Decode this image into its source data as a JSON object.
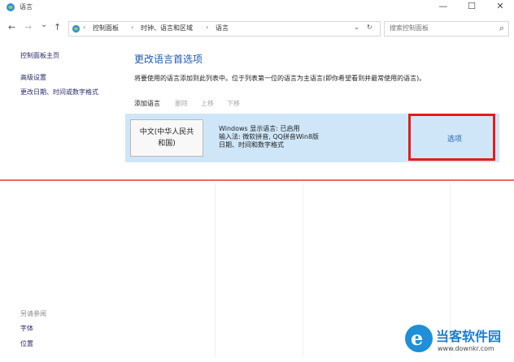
{
  "window": {
    "title": "语言",
    "minimize": "—",
    "maximize": "☐",
    "close": "✕"
  },
  "address": {
    "back": "←",
    "forward": "→",
    "recent": "⌄",
    "up": "↑",
    "path": [
      "控制面板",
      "时钟、语言和区域",
      "语言"
    ],
    "separator": "›",
    "dropdown": "⌄",
    "refresh": "↻",
    "search_placeholder": "搜索控制面板",
    "search_icon": "⌕"
  },
  "sidebar": {
    "home": "控制面板主页",
    "advanced": "高级设置",
    "change_date": "更改日期、时间或数字格式",
    "see_also": "另请参阅",
    "font": "字体",
    "location": "位置"
  },
  "main": {
    "heading": "更改语言首选项",
    "description": "将要使用的语言添加到此列表中。位于列表第一位的语言为主语言(即你希望看到并最常使用的语言)。",
    "toolbar": {
      "add": "添加语言",
      "remove": "删除",
      "up": "上移",
      "down": "下移"
    },
    "language": {
      "name_line1": "中文(中华人民共",
      "name_line2": "和国)",
      "display_lang": "Windows 显示语言: 已启用",
      "input_method": "输入法: 微软拼音, QQ拼音Win8版",
      "date_format": "日期、时间和数字格式",
      "options": "选项"
    }
  },
  "watermark": {
    "name": "当客软件园",
    "url": "www.downkr.com",
    "logo_letter": "e"
  },
  "colors": {
    "accent": "#1e5aa8",
    "selected_row": "#cfe6f8",
    "highlight": "#e51c1c"
  }
}
